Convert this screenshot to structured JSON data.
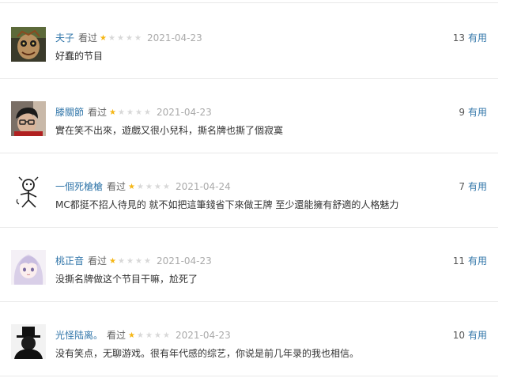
{
  "comments": [
    {
      "author": "夫子",
      "status": "看过",
      "rating": 1,
      "rating_max": 5,
      "date": "2021-04-23",
      "votes": "13",
      "vote_label": "有用",
      "text": "好蠢的节目",
      "avatar_icon": "avatar-masked-face-icon"
    },
    {
      "author": "滕關節",
      "status": "看过",
      "rating": 1,
      "rating_max": 5,
      "date": "2021-04-23",
      "votes": "9",
      "vote_label": "有用",
      "text": "實在笑不出來，遊戲又很小兒科，撕名牌也撕了個寂寞",
      "avatar_icon": "avatar-person-glasses-icon"
    },
    {
      "author": "一個死槍槍",
      "status": "看过",
      "rating": 1,
      "rating_max": 5,
      "date": "2021-04-24",
      "votes": "7",
      "vote_label": "有用",
      "text": "MC都挺不招人待見的 就不如把這筆錢省下來做王牌 至少還能擁有舒適的人格魅力",
      "avatar_icon": "avatar-doodle-figure-icon"
    },
    {
      "author": "桃正音",
      "status": "看过",
      "rating": 1,
      "rating_max": 5,
      "date": "2021-04-23",
      "votes": "11",
      "vote_label": "有用",
      "text": "没撕名牌做这个节目干嘛，尬死了",
      "avatar_icon": "avatar-anime-girl-icon"
    },
    {
      "author": "光怪陆离。",
      "status": "看过",
      "rating": 1,
      "rating_max": 5,
      "date": "2021-04-23",
      "votes": "10",
      "vote_label": "有用",
      "text": "没有笑点，无聊游戏。很有年代感的综艺，你说是前几年录的我也相信。",
      "avatar_icon": "avatar-hat-silhouette-icon"
    }
  ],
  "colors": {
    "link": "#3377aa",
    "star_on": "#f5b614",
    "star_off": "#d8d8d8",
    "date": "#aaaaaa",
    "divider": "#e9e9e9"
  }
}
